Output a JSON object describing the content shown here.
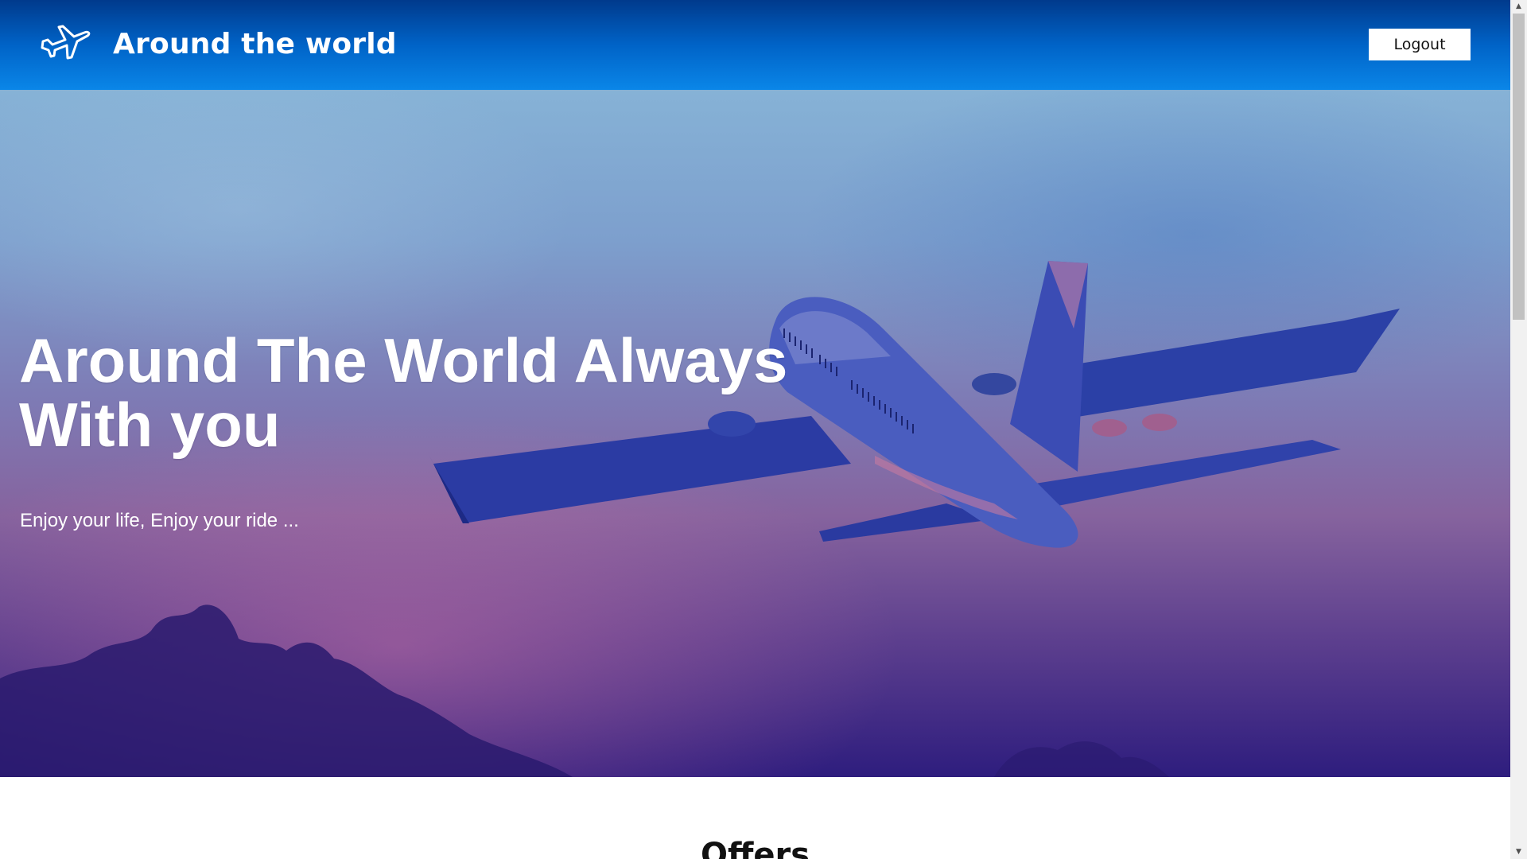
{
  "header": {
    "brand": "Around the world",
    "logo_icon": "airplane-icon",
    "logout_label": "Logout"
  },
  "hero": {
    "title": "Around The World Always With you",
    "subtitle": "Enjoy your life, Enjoy your ride ...",
    "image": "airplane-in-sunset-sky"
  },
  "offers": {
    "title": "Offers"
  },
  "colors": {
    "header_top": "#003a8c",
    "header_bottom": "#0a86e8",
    "hero_sky_top": "#86b2d6",
    "hero_sky_bottom": "#2e1d7e",
    "text_light": "#ffffff"
  }
}
